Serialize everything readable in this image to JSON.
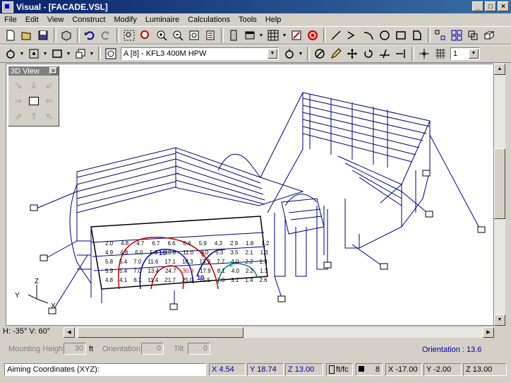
{
  "window": {
    "title": "Visual - [FACADE.VSL]"
  },
  "menu": [
    "File",
    "Edit",
    "View",
    "Construct",
    "Modify",
    "Luminaire",
    "Calculations",
    "Tools",
    "Help"
  ],
  "toolbar2": {
    "luminaire_select": "A [8] - KFL3 400M HPW",
    "layer_value": "1"
  },
  "panel3d": {
    "title": "3D View"
  },
  "view": {
    "hv": "H: -35°  V: 60°"
  },
  "axis": {
    "x": "X",
    "y": "Y",
    "z": "Z"
  },
  "calc_labels": {
    "row1": [
      "2.0",
      "4.8",
      "4.7",
      "6.7",
      "6.6",
      "6.6",
      "5.9",
      "4.3",
      "2.9",
      "1.8",
      "1.2"
    ],
    "row2": [
      "4.9",
      "4.8",
      "6.0",
      "5.3",
      "10.8",
      "11.0",
      "9.0",
      "5.3",
      "3.5",
      "2.1",
      "1.3"
    ],
    "row3": [
      "5.8",
      "5.4",
      "7.0",
      "11.6",
      "17.1",
      "18.3",
      "13.9",
      "7.7",
      "4.0",
      "2.2",
      "1.3"
    ],
    "row4": [
      "5.9",
      "5.4",
      "7.0",
      "13.4",
      "24.7",
      "30.9",
      "17.9",
      "8.1",
      "4.0",
      "2.2",
      "1.3"
    ],
    "row5": [
      "4.8",
      "4.1",
      "6.1",
      "11.4",
      "21.7",
      "25.0",
      "15.5",
      "7.0",
      "3.1",
      "1.4",
      "2.6"
    ],
    "contours": [
      "10",
      "5",
      "10",
      "2"
    ]
  },
  "mounting": {
    "label": "Mounting Height",
    "value": "30",
    "unit": "ft",
    "orientation_label": "Orientation",
    "orientation_value": "0",
    "tilt_label": "Tilt",
    "tilt_value": "0",
    "orientation_display": "Orientation : 13.6"
  },
  "status": {
    "prompt": "Aiming Coordinates (XYZ):",
    "x1": "X  4.54",
    "y1": "Y  18.74",
    "z1": "Z  13.00",
    "units": "ft/fc",
    "layer": "8",
    "x2": "X  -17.00",
    "y2": "Y  -2.00",
    "z2": "Z  13.00"
  }
}
